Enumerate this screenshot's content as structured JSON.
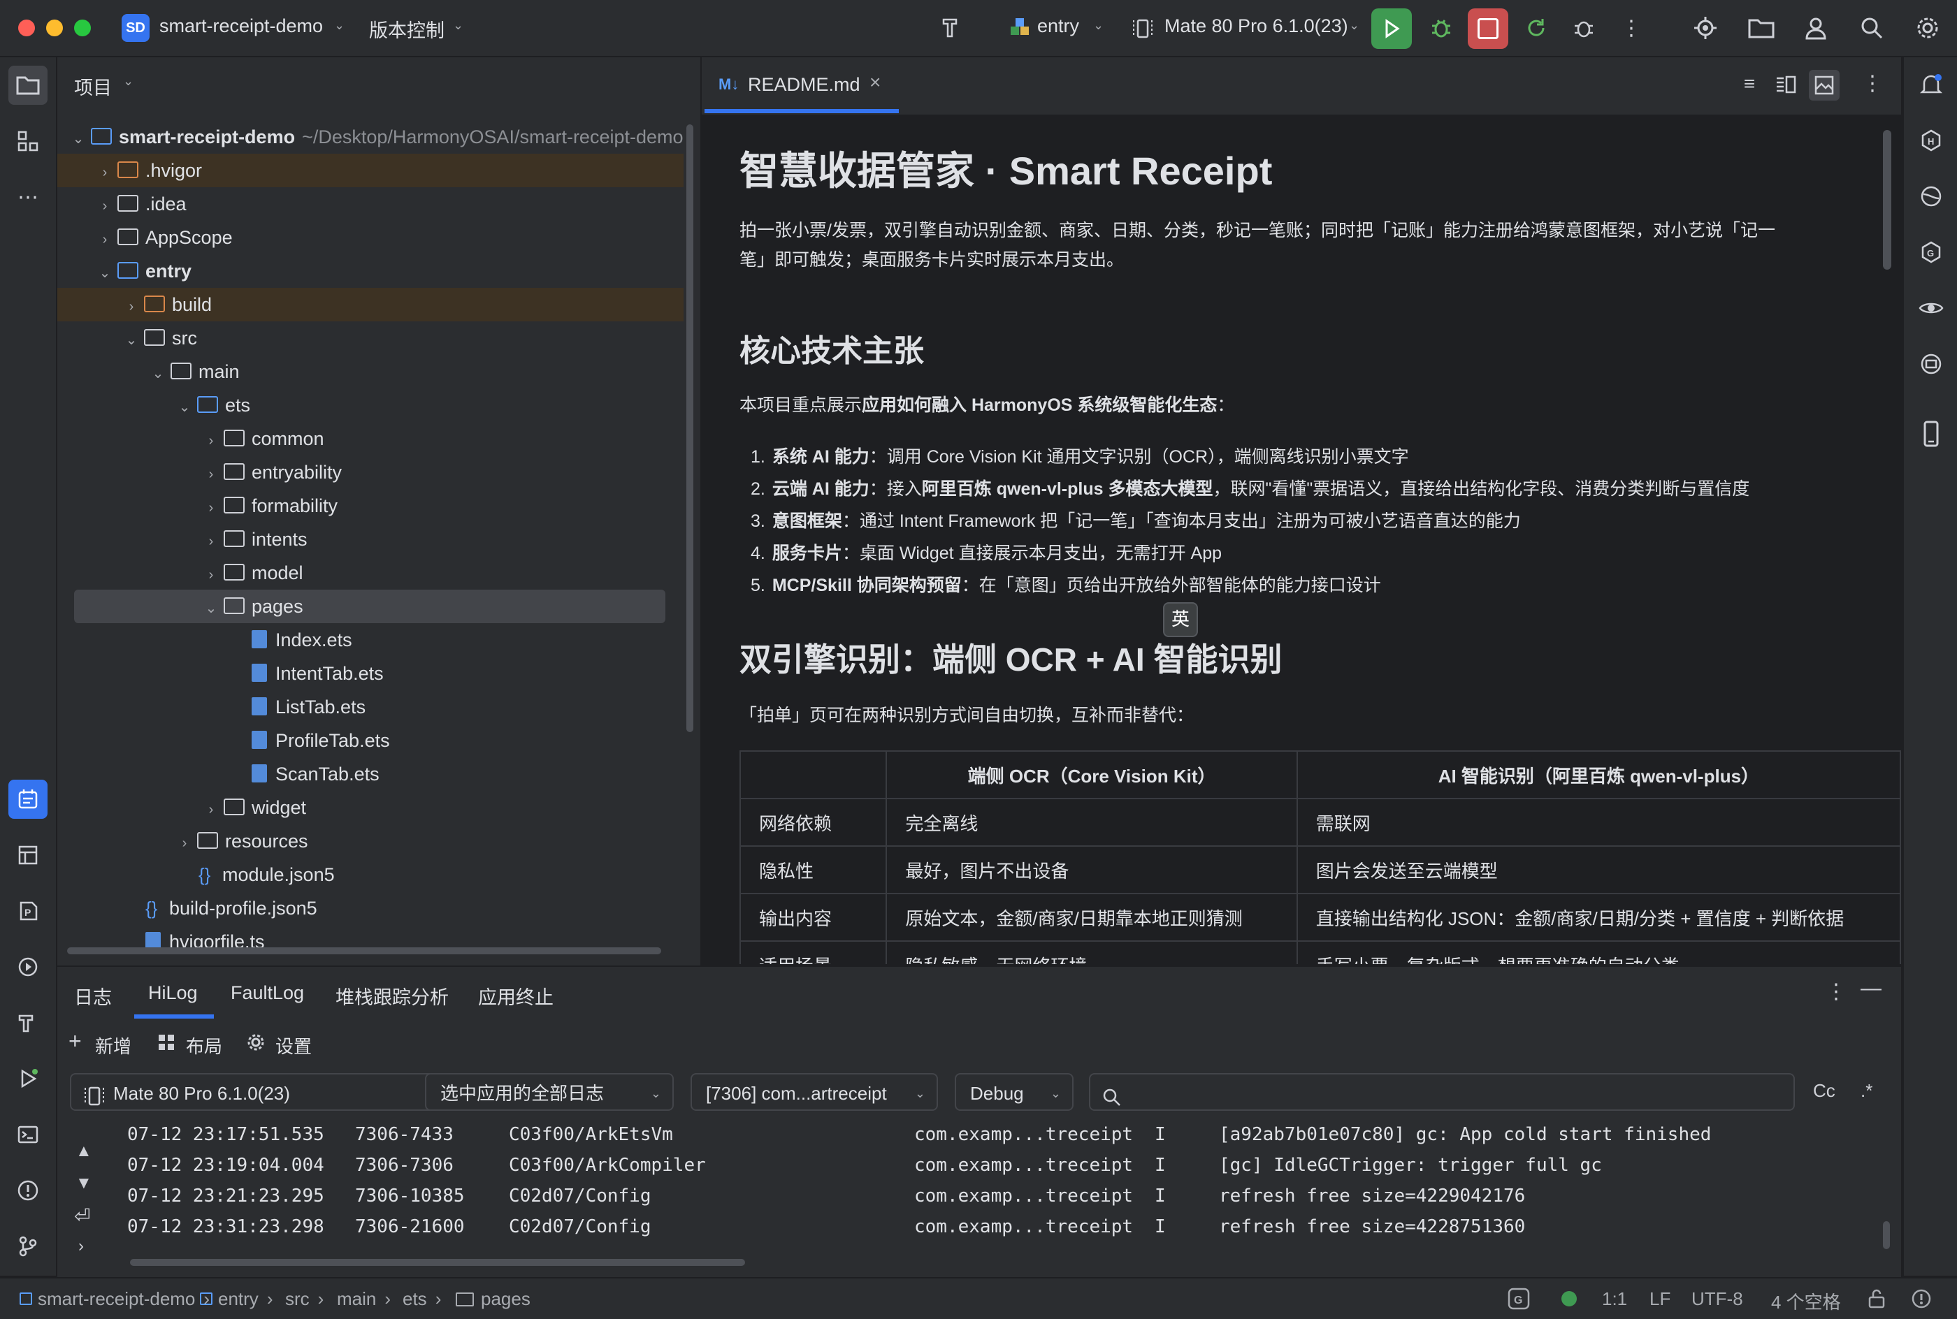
{
  "titlebar": {
    "project_badge": "SD",
    "project_name": "smart-receipt-demo",
    "vcs_menu": "版本控制",
    "module_selector": "entry",
    "device_selector": "Mate 80 Pro 6.1.0(23)",
    "colors": {
      "run_green": "#3f9a52",
      "stop_red": "#c94f4f",
      "badge_blue": "#3574f0"
    }
  },
  "project_panel": {
    "title": "项目",
    "tree": [
      {
        "label": "smart-receipt-demo",
        "extra": "~/Desktop/HarmonyOSAI/smart-receipt-demo",
        "depth": 0,
        "expanded": true,
        "icon": "module-folder-icon",
        "bold": true
      },
      {
        "label": ".hvigor",
        "depth": 1,
        "expanded": false,
        "icon": "folder-icon",
        "highlight": "excluded"
      },
      {
        "label": ".idea",
        "depth": 1,
        "expanded": false,
        "icon": "folder-icon"
      },
      {
        "label": "AppScope",
        "depth": 1,
        "expanded": false,
        "icon": "folder-icon"
      },
      {
        "label": "entry",
        "depth": 1,
        "expanded": true,
        "icon": "module-folder-icon",
        "bold": true
      },
      {
        "label": "build",
        "depth": 2,
        "expanded": false,
        "icon": "folder-icon",
        "highlight": "excluded"
      },
      {
        "label": "src",
        "depth": 2,
        "expanded": true,
        "icon": "folder-icon"
      },
      {
        "label": "main",
        "depth": 3,
        "expanded": true,
        "icon": "folder-icon"
      },
      {
        "label": "ets",
        "depth": 4,
        "expanded": true,
        "icon": "source-folder-icon"
      },
      {
        "label": "common",
        "depth": 5,
        "expanded": false,
        "icon": "folder-icon"
      },
      {
        "label": "entryability",
        "depth": 5,
        "expanded": false,
        "icon": "folder-icon"
      },
      {
        "label": "formability",
        "depth": 5,
        "expanded": false,
        "icon": "folder-icon"
      },
      {
        "label": "intents",
        "depth": 5,
        "expanded": false,
        "icon": "folder-icon"
      },
      {
        "label": "model",
        "depth": 5,
        "expanded": false,
        "icon": "folder-icon"
      },
      {
        "label": "pages",
        "depth": 5,
        "expanded": true,
        "icon": "folder-icon",
        "selected": true
      },
      {
        "label": "Index.ets",
        "depth": 6,
        "icon": "ets-file-icon"
      },
      {
        "label": "IntentTab.ets",
        "depth": 6,
        "icon": "ets-file-icon"
      },
      {
        "label": "ListTab.ets",
        "depth": 6,
        "icon": "ets-file-icon"
      },
      {
        "label": "ProfileTab.ets",
        "depth": 6,
        "icon": "ets-file-icon"
      },
      {
        "label": "ScanTab.ets",
        "depth": 6,
        "icon": "ets-file-icon"
      },
      {
        "label": "widget",
        "depth": 5,
        "expanded": false,
        "icon": "folder-icon"
      },
      {
        "label": "resources",
        "depth": 4,
        "expanded": false,
        "icon": "folder-icon"
      },
      {
        "label": "module.json5",
        "depth": 4,
        "icon": "json-file-icon"
      },
      {
        "label": "build-profile.json5",
        "depth": 2,
        "icon": "json-file-icon"
      },
      {
        "label": "hvigorfile.ts",
        "depth": 2,
        "icon": "ts-file-icon"
      }
    ]
  },
  "editor": {
    "tab_badge": "M↓",
    "tab_label": "README.md",
    "ime_indicator": "英",
    "h1": "智慧收据管家 · Smart Receipt",
    "intro_line1": "拍一张小票/发票，双引擎自动识别金额、商家、日期、分类，秒记一笔账；同时把「记账」能力注册给鸿蒙意图框架，对小艺说「记一",
    "intro_line2": "笔」即可触发；桌面服务卡片实时展示本月支出。",
    "h2a": "核心技术主张",
    "lead_a_prefix": "本项目重点展示",
    "lead_a_bold": "应用如何融入 HarmonyOS 系统级智能化生态",
    "lead_a_suffix": "：",
    "list": [
      {
        "num": "1.",
        "bold": "系统 AI 能力",
        "text": "：调用 Core Vision Kit 通用文字识别（OCR），端侧离线识别小票文字"
      },
      {
        "num": "2.",
        "bold": "云端 AI 能力",
        "text": "：接入",
        "bold2": "阿里百炼 qwen-vl-plus 多模态大模型",
        "text2": "，联网\"看懂\"票据语义，直接给出结构化字段、消费分类判断与置信度"
      },
      {
        "num": "3.",
        "bold": "意图框架",
        "text": "：通过 Intent Framework 把「记一笔」「查询本月支出」注册为可被小艺语音直达的能力"
      },
      {
        "num": "4.",
        "bold": "服务卡片",
        "text": "：桌面 Widget 直接展示本月支出，无需打开 App"
      },
      {
        "num": "5.",
        "bold": "MCP/Skill 协同架构预留",
        "text": "：在「意图」页给出开放给外部智能体的能力接口设计"
      }
    ],
    "h2b": "双引擎识别：端侧 OCR + AI 智能识别",
    "lead_b": "「拍单」页可在两种识别方式间自由切换，互补而非替代：",
    "table": {
      "headers": [
        "",
        "端侧 OCR（Core Vision Kit）",
        "AI 智能识别（阿里百炼 qwen-vl-plus）"
      ],
      "rows": [
        [
          "网络依赖",
          "完全离线",
          "需联网"
        ],
        [
          "隐私性",
          "最好，图片不出设备",
          "图片会发送至云端模型"
        ],
        [
          "输出内容",
          "原始文本，金额/商家/日期靠本地正则猜测",
          "直接输出结构化 JSON：金额/商家/日期/分类 + 置信度 + 判断依据"
        ],
        [
          "适用场景",
          "隐私敏感、无网络环境",
          "手写小票、复杂版式、想要更准确的自动分类"
        ]
      ]
    }
  },
  "bottom_panel": {
    "tabs": [
      "日志",
      "HiLog",
      "FaultLog",
      "堆栈跟踪分析",
      "应用终止"
    ],
    "active_tab": "HiLog",
    "toolbar": {
      "add": "新增",
      "layout": "布局",
      "settings": "设置"
    },
    "filters": {
      "device": "Mate 80 Pro 6.1.0(23)",
      "scope": "选中应用的全部日志",
      "process": "[7306] com...artreceipt",
      "level": "Debug",
      "search_value": "",
      "case_toggle": "Cc",
      "regex_toggle": ".*"
    },
    "log_rows": [
      {
        "time": "07-12 23:17:51.535",
        "pid": "7306-7433",
        "tag": "C03f00/ArkEtsVm",
        "pkg": "com.examp...treceipt",
        "level": "I",
        "msg": "[a92ab7b01e07c80] gc: App cold start finished"
      },
      {
        "time": "07-12 23:19:04.004",
        "pid": "7306-7306",
        "tag": "C03f00/ArkCompiler",
        "pkg": "com.examp...treceipt",
        "level": "I",
        "msg": "[gc] IdleGCTrigger: trigger full gc"
      },
      {
        "time": "07-12 23:21:23.295",
        "pid": "7306-10385",
        "tag": "C02d07/Config",
        "pkg": "com.examp...treceipt",
        "level": "I",
        "msg": "refresh free size=4229042176"
      },
      {
        "time": "07-12 23:31:23.298",
        "pid": "7306-21600",
        "tag": "C02d07/Config",
        "pkg": "com.examp...treceipt",
        "level": "I",
        "msg": "refresh free size=4228751360"
      }
    ]
  },
  "statusbar": {
    "breadcrumb": [
      "smart-receipt-demo",
      "entry",
      "src",
      "main",
      "ets",
      "pages"
    ],
    "position": "1:1",
    "line_ending": "LF",
    "encoding": "UTF-8",
    "indent": "4 个空格"
  }
}
